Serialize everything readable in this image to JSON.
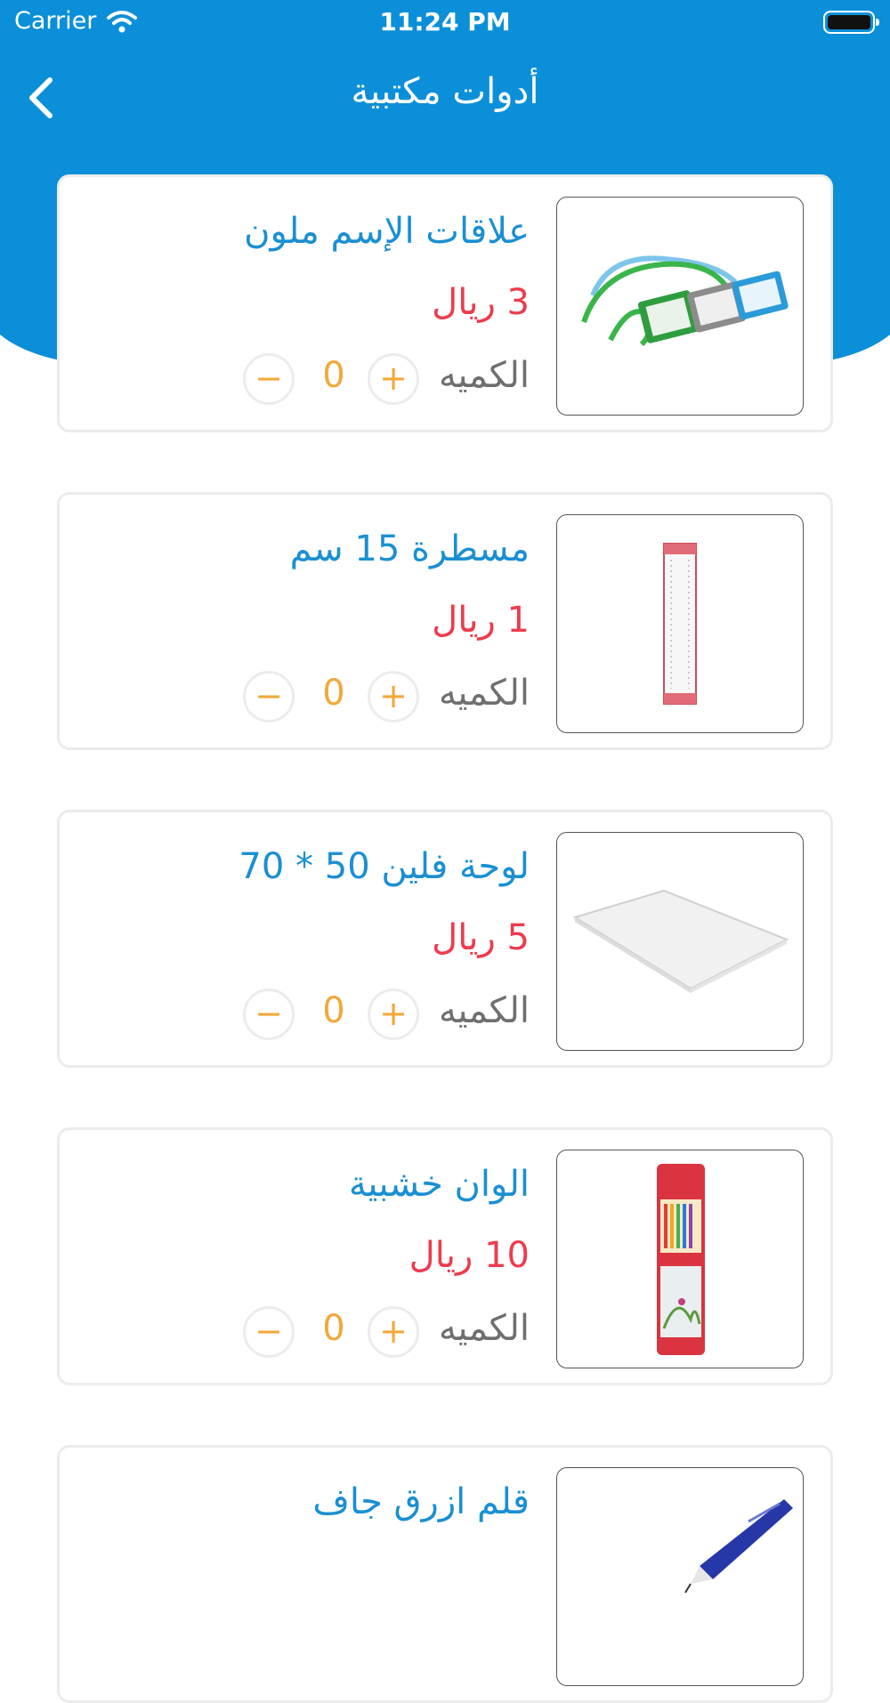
{
  "status_bar": {
    "carrier": "Carrier",
    "time": "11:24 PM"
  },
  "nav": {
    "title": "أدوات مكتبية",
    "back_icon": "chevron-left-icon"
  },
  "colors": {
    "primary": "#0b8fd8",
    "price": "#ee3b4e",
    "accent": "#f2a93b",
    "name": "#1a8fd2"
  },
  "products": [
    {
      "name": "علاقات الإسم ملون",
      "price": "3 ريال",
      "qty_label": "الكميه",
      "qty": "0",
      "plus": "+",
      "minus": "−"
    },
    {
      "name": "مسطرة 15 سم",
      "price": "1 ريال",
      "qty_label": "الكميه",
      "qty": "0",
      "plus": "+",
      "minus": "−"
    },
    {
      "name": "لوحة فلين 50 * 70",
      "price": "5 ريال",
      "qty_label": "الكميه",
      "qty": "0",
      "plus": "+",
      "minus": "−"
    },
    {
      "name": "الوان خشبية",
      "price": "10 ريال",
      "qty_label": "الكميه",
      "qty": "0",
      "plus": "+",
      "minus": "−"
    },
    {
      "name": "قلم ازرق جاف"
    }
  ]
}
